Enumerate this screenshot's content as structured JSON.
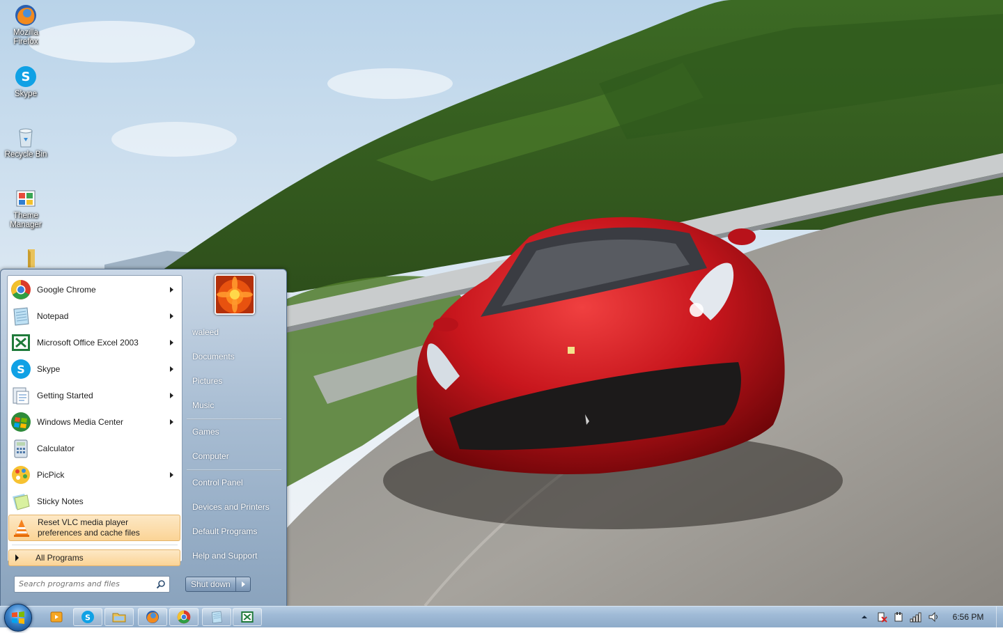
{
  "desktop": {
    "icons": [
      {
        "label": "Mozilla\nFirefox"
      },
      {
        "label": "Skype"
      },
      {
        "label": "Recycle Bin"
      },
      {
        "label": "Theme\nManager"
      },
      {
        "label": ""
      }
    ]
  },
  "start_menu": {
    "programs": [
      {
        "label": "Google Chrome",
        "has_submenu": true,
        "icon": "chrome-icon"
      },
      {
        "label": "Notepad",
        "has_submenu": true,
        "icon": "notepad-icon"
      },
      {
        "label": "Microsoft Office Excel 2003",
        "has_submenu": true,
        "icon": "excel-icon"
      },
      {
        "label": "Skype",
        "has_submenu": true,
        "icon": "skype-icon"
      },
      {
        "label": "Getting Started",
        "has_submenu": true,
        "icon": "getting-started-icon"
      },
      {
        "label": "Windows Media Center",
        "has_submenu": true,
        "icon": "media-center-icon"
      },
      {
        "label": "Calculator",
        "has_submenu": false,
        "icon": "calculator-icon"
      },
      {
        "label": "PicPick",
        "has_submenu": true,
        "icon": "picpick-icon"
      },
      {
        "label": "Sticky Notes",
        "has_submenu": false,
        "icon": "sticky-notes-icon"
      },
      {
        "label": "Reset VLC media player\npreferences and cache files",
        "has_submenu": false,
        "icon": "vlc-icon",
        "highlighted": true
      }
    ],
    "all_programs_label": "All Programs",
    "search_placeholder": "Search programs and files",
    "right_items": {
      "user": "waleed",
      "documents": "Documents",
      "pictures": "Pictures",
      "music": "Music",
      "games": "Games",
      "computer": "Computer",
      "control_panel": "Control Panel",
      "devices": "Devices and Printers",
      "default_programs": "Default Programs",
      "help": "Help and Support"
    },
    "shutdown_label": "Shut down"
  },
  "taskbar": {
    "pinned": [
      "media-player-icon",
      "skype-icon",
      "explorer-icon",
      "firefox-icon",
      "chrome-icon",
      "notepad-icon",
      "excel-icon"
    ],
    "clock": "6:56 PM"
  },
  "colors": {
    "highlight": "#fbd496",
    "taskbar": "#9fbad6",
    "car": "#c8161d"
  }
}
